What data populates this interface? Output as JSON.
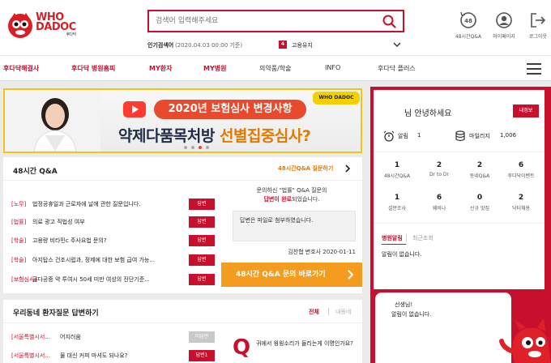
{
  "brand": {
    "logo_top": "WHO",
    "logo_bottom": "DADOC",
    "logo_sub": "후다닥",
    "primary_color": "#c8102e",
    "accent_color": "#f39c1f"
  },
  "header": {
    "search_placeholder": "검색어 입력해주세요",
    "popular_label": "인기검색어",
    "popular_date": "(2020.04.03 00:00 기준)",
    "popular_rank": "4",
    "popular_keyword": "고용유지",
    "icons": [
      {
        "name": "48-hour-qa",
        "label": "48시간Q&A",
        "badge": "48"
      },
      {
        "name": "my-page",
        "label": "마이페이지"
      },
      {
        "name": "logout",
        "label": "로그아웃"
      }
    ]
  },
  "nav": {
    "items": [
      {
        "label": "후다닥해결사",
        "style": "red"
      },
      {
        "label": "후다닥 병원홈피",
        "style": "red"
      },
      {
        "label": "MY환자",
        "style": "red"
      },
      {
        "label": "MY병원",
        "style": "red"
      },
      {
        "label": "의약품/학술",
        "style": "dark"
      },
      {
        "label": "INFO",
        "style": "dark"
      },
      {
        "label": "후다닥 플러스",
        "style": "dark"
      }
    ]
  },
  "banner": {
    "pill": "2020년 보험심사 변경사항",
    "title_a": "약제다품목처방 ",
    "title_b": "선별집중심사?",
    "badge": "WHO DADOC"
  },
  "qa": {
    "title": "48시간 Q&A",
    "link": "48시간Q&A 질문하기",
    "rows": [
      {
        "cat": "[노무]",
        "text": "법정공휴일과 근로자에 날에 관한 질문입니다.",
        "btn": "답변"
      },
      {
        "cat": "[법률]",
        "text": "의료 광고 직법성 여부",
        "btn": "답변"
      },
      {
        "cat": "[학술]",
        "text": "고용량 비타민c 주사요법 문의?",
        "btn": "답변"
      },
      {
        "cat": "[학술]",
        "text": "아지탑스 건조시럽과, 정제에 대한 보험 급여 가능...",
        "btn": "답변"
      },
      {
        "cat": "[보험심사]",
        "text": "골다공증 약 투여시 50세 미만 여성의 진단기준...",
        "btn": "답변"
      }
    ],
    "side_line1": "문의하신 \"법률\" Q&A 질문의",
    "side_line2_hl": "답변이 완료",
    "side_line2_rest": "되었습니다.",
    "side_box": "답변은 파일로 첨부하였습니다.",
    "side_sig": "김찬협 변호사 2020-01-11",
    "cta": "48시간 Q&A 문의 바로가기"
  },
  "neighborhood": {
    "title": "우리동네 환자질문 답변하기",
    "tab_all": "전체",
    "tab_mine": "내동네",
    "rows": [
      {
        "cat": "[서울특별시서...",
        "text": "어지러움",
        "btn": "미답변",
        "style": "grey"
      },
      {
        "cat": "[서울특별시서...",
        "text": "물 대신 커피 마셔도 되나요?",
        "btn": "답변1",
        "style": "red"
      }
    ],
    "q_mark": "Q",
    "q_text": "귀에서 윙윙소리가 들리는게 이명인가요?"
  },
  "profile": {
    "greeting": "님 안녕하세요",
    "info_btn": "내정보",
    "alarm_label": "알림",
    "alarm_value": "1",
    "mileage_label": "마일리지",
    "mileage_value": "1,006",
    "grid": [
      {
        "n": "1",
        "t": "48시간Q&A"
      },
      {
        "n": "2",
        "t": "Dr to Dr"
      },
      {
        "n": "2",
        "t": "동네Q&A"
      },
      {
        "n": "6",
        "t": "후다닥이벤트"
      },
      {
        "n": "1",
        "t": "설문조사"
      },
      {
        "n": "6",
        "t": "웨비나"
      },
      {
        "n": "0",
        "t": "신규 맛집"
      },
      {
        "n": "2",
        "t": "닥터채용"
      }
    ],
    "tab_alarm": "병원알림",
    "tab_recent": "최근조회",
    "empty_text": "알림이 없습니다.",
    "bubble_name": "선생님!",
    "bubble_text": "알림이 없습니다."
  }
}
